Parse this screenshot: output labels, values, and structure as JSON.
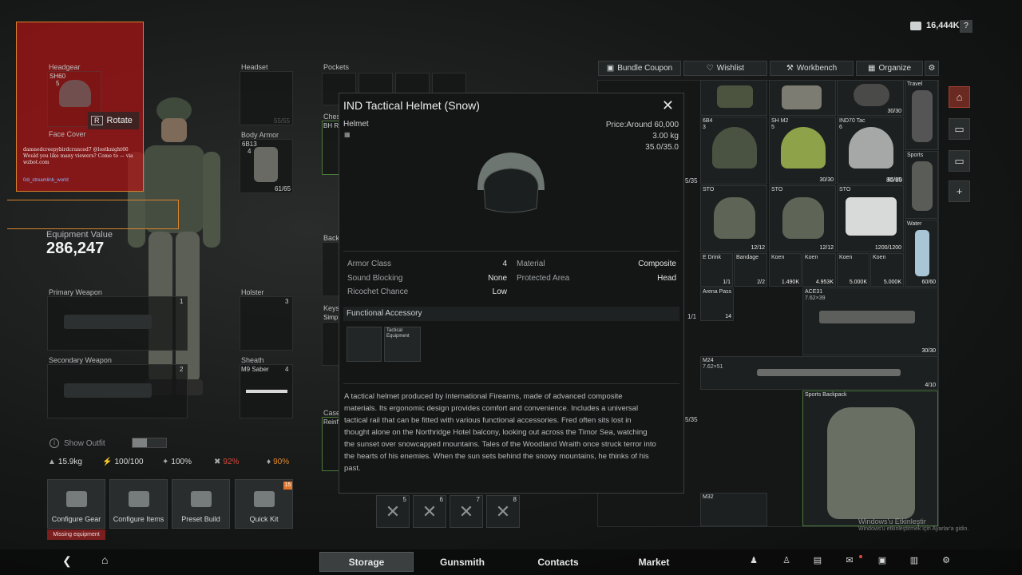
{
  "currency": {
    "amount": "16,444K",
    "help": "?"
  },
  "top_buttons": [
    {
      "label": "Bundle Coupon",
      "icon": "bundle-icon"
    },
    {
      "label": "Wishlist",
      "icon": "heart-icon"
    },
    {
      "label": "Workbench",
      "icon": "wrench-icon"
    },
    {
      "label": "Organize",
      "icon": "organize-icon"
    }
  ],
  "overlay": {
    "rotate_key": "R",
    "rotate_label": "Rotate",
    "chat_text": "damnedcreepybirdcranced7 @lostknight66 Would you like many viewers? Come to — via wzbot.com",
    "streamer": "0di_streamlinb_world"
  },
  "slots": {
    "headgear": {
      "label": "Headgear",
      "model": "SH60",
      "count": "5"
    },
    "face_cover": {
      "label": "Face Cover"
    },
    "headset": {
      "label": "Headset",
      "durability": "55/55"
    },
    "pockets": {
      "label": "Pockets"
    },
    "body_armor": {
      "label": "Body Armor",
      "model": "6B13",
      "count": "4",
      "durability": "61/65"
    },
    "chest": {
      "label": "Ches",
      "sub": "BH R"
    },
    "back": {
      "label": "Back"
    },
    "keys": {
      "label": "Keys",
      "sub": "Simp"
    },
    "case": {
      "label": "Case",
      "sub": "Reinf"
    },
    "primary": {
      "label": "Primary Weapon",
      "num": "1"
    },
    "secondary": {
      "label": "Secondary Weapon",
      "num": "2"
    },
    "holster": {
      "label": "Holster",
      "num": "3"
    },
    "sheath": {
      "label": "Sheath",
      "model": "M9 Saber",
      "num": "4"
    }
  },
  "equipment_value": {
    "label": "Equipment Value",
    "value": "286,247"
  },
  "show_outfit": "Show Outfit",
  "stats": [
    {
      "icon": "weight-icon",
      "value": "15.9kg",
      "color": "#d8dada"
    },
    {
      "icon": "run-icon",
      "value": "100/100",
      "color": "#d8dada"
    },
    {
      "icon": "stamina-icon",
      "value": "100%",
      "color": "#d8dada"
    },
    {
      "icon": "hunger-icon",
      "value": "92%",
      "color": "#d84a3a"
    },
    {
      "icon": "hydration-icon",
      "value": "90%",
      "color": "#e58a2a"
    }
  ],
  "quick_buttons": [
    {
      "label": "Configure Gear"
    },
    {
      "label": "Configure Items"
    },
    {
      "label": "Preset Build"
    },
    {
      "label": "Quick Kit",
      "badge": "15"
    }
  ],
  "missing_equipment": "Missing equipment",
  "quick_slots": [
    "5",
    "6",
    "7",
    "8"
  ],
  "item_panel": {
    "title": "IND Tactical Helmet (Snow)",
    "category": "Helmet",
    "price": "Price:Around 60,000",
    "weight": "3.00 kg",
    "durability": "35.0/35.0",
    "stats_left": [
      {
        "k": "Armor Class",
        "v": "4"
      },
      {
        "k": "Sound Blocking",
        "v": "None"
      },
      {
        "k": "Ricochet Chance",
        "v": "Low"
      }
    ],
    "stats_right": [
      {
        "k": "Material",
        "v": "Composite"
      },
      {
        "k": "Protected Area",
        "v": "Head"
      }
    ],
    "functional_title": "Functional Accessory",
    "accessory_label": "Tactical Equipment",
    "description": "A tactical helmet produced by International Firearms, made of advanced composite materials. Its ergonomic design provides comfort and convenience. Includes a universal tactical rail that can be fitted with various functional accessories. Fred often sits lost in thought alone on the Northridge Hotel balcony, looking out across the Timor Sea, watching the sunset over snowcapped mountains. Tales of the Woodland Wraith once struck terror into the hearts of his enemies. When the sun sets behind the snowy mountains, he thinks of his past."
  },
  "storage_items": [
    {
      "name": "6B4",
      "count": "",
      "badge": "3"
    },
    {
      "name": "SH M2",
      "count": "30/30",
      "badge": "5"
    },
    {
      "name": "IND70 Tac",
      "count": "65/65",
      "badge": "6"
    },
    {
      "name": "",
      "count": "80/80"
    },
    {
      "name": "Travel",
      "count": "30/30"
    },
    {
      "name": "STO",
      "count": "12/12"
    },
    {
      "name": "STO",
      "count": "12/12"
    },
    {
      "name": "STO",
      "count": "1200/1200"
    },
    {
      "name": "Sports",
      "count": ""
    },
    {
      "name": "Water",
      "count": "60/60"
    },
    {
      "name": "E Drink",
      "count": "1/1"
    },
    {
      "name": "Bandage",
      "count": "2/2"
    },
    {
      "name": "Koen",
      "count": "1.490K"
    },
    {
      "name": "Koen",
      "count": "4.953K"
    },
    {
      "name": "Koen",
      "count": "5.000K"
    },
    {
      "name": "Koen",
      "count": "5.000K"
    },
    {
      "name": "Arena Pass",
      "count": "14"
    },
    {
      "name": "ACE31",
      "sub": "7.62×39",
      "count": "30/30"
    },
    {
      "name": "M24",
      "sub": "7.62×51",
      "count": "4/10"
    },
    {
      "name": "Sports Backpack",
      "count": ""
    },
    {
      "name": "M32",
      "count": ""
    }
  ],
  "left_counts": [
    "5/35",
    "1/1",
    "5/35"
  ],
  "nav_tabs": [
    "Storage",
    "Gunsmith",
    "Contacts",
    "Market"
  ],
  "windows_notice": {
    "title": "Windows'u Etkinleştir",
    "sub": "Windows'u etkinleştirmek için Ayarlar'a gidin."
  }
}
